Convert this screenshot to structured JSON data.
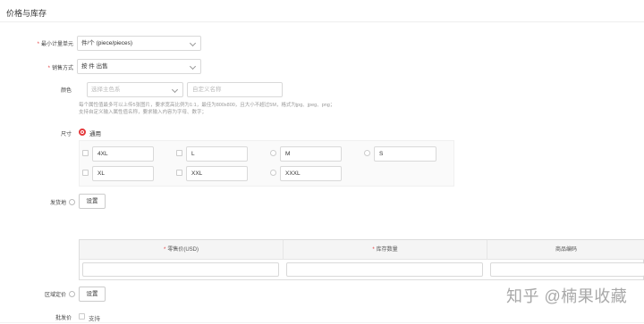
{
  "section": {
    "title": "价格与库存"
  },
  "unit": {
    "label": "最小计量单元",
    "value": "件/个 (piece/pieces)"
  },
  "sale": {
    "label": "销售方式",
    "value": "按 件 出售"
  },
  "color": {
    "label": "颜色",
    "main_placeholder": "选择主色系",
    "custom_placeholder": "自定义名称",
    "hint_line1": "每个属性值最多可以上传5张图片，要求宽高比例为1:1，最佳为800x800，且大小不超过5M，格式为jpg、jpeg、png；",
    "hint_line2": "支持自定义输入属性值名称，要求输入内容为字母、数字；"
  },
  "size": {
    "label": "尺寸",
    "radio_label": "通用",
    "options": [
      "4XL",
      "L",
      "M",
      "S",
      "XL",
      "XXL",
      "XXXL"
    ]
  },
  "shipping": {
    "label": "发货地",
    "button": "设置"
  },
  "table": {
    "headers": [
      "零售价(USD)",
      "库存数量",
      "商品编码"
    ],
    "required_marks": [
      "*",
      "*",
      ""
    ]
  },
  "region_price": {
    "label": "区域定价",
    "button": "设置"
  },
  "wholesale": {
    "label": "批发价",
    "option": "支持"
  },
  "watermark": "知乎 @楠果收藏",
  "colors": {
    "required": "#e4393c",
    "border": "#d9d9d9"
  },
  "icons": {
    "help": "help-circle-icon",
    "dropdown": "chevron-down-icon"
  }
}
